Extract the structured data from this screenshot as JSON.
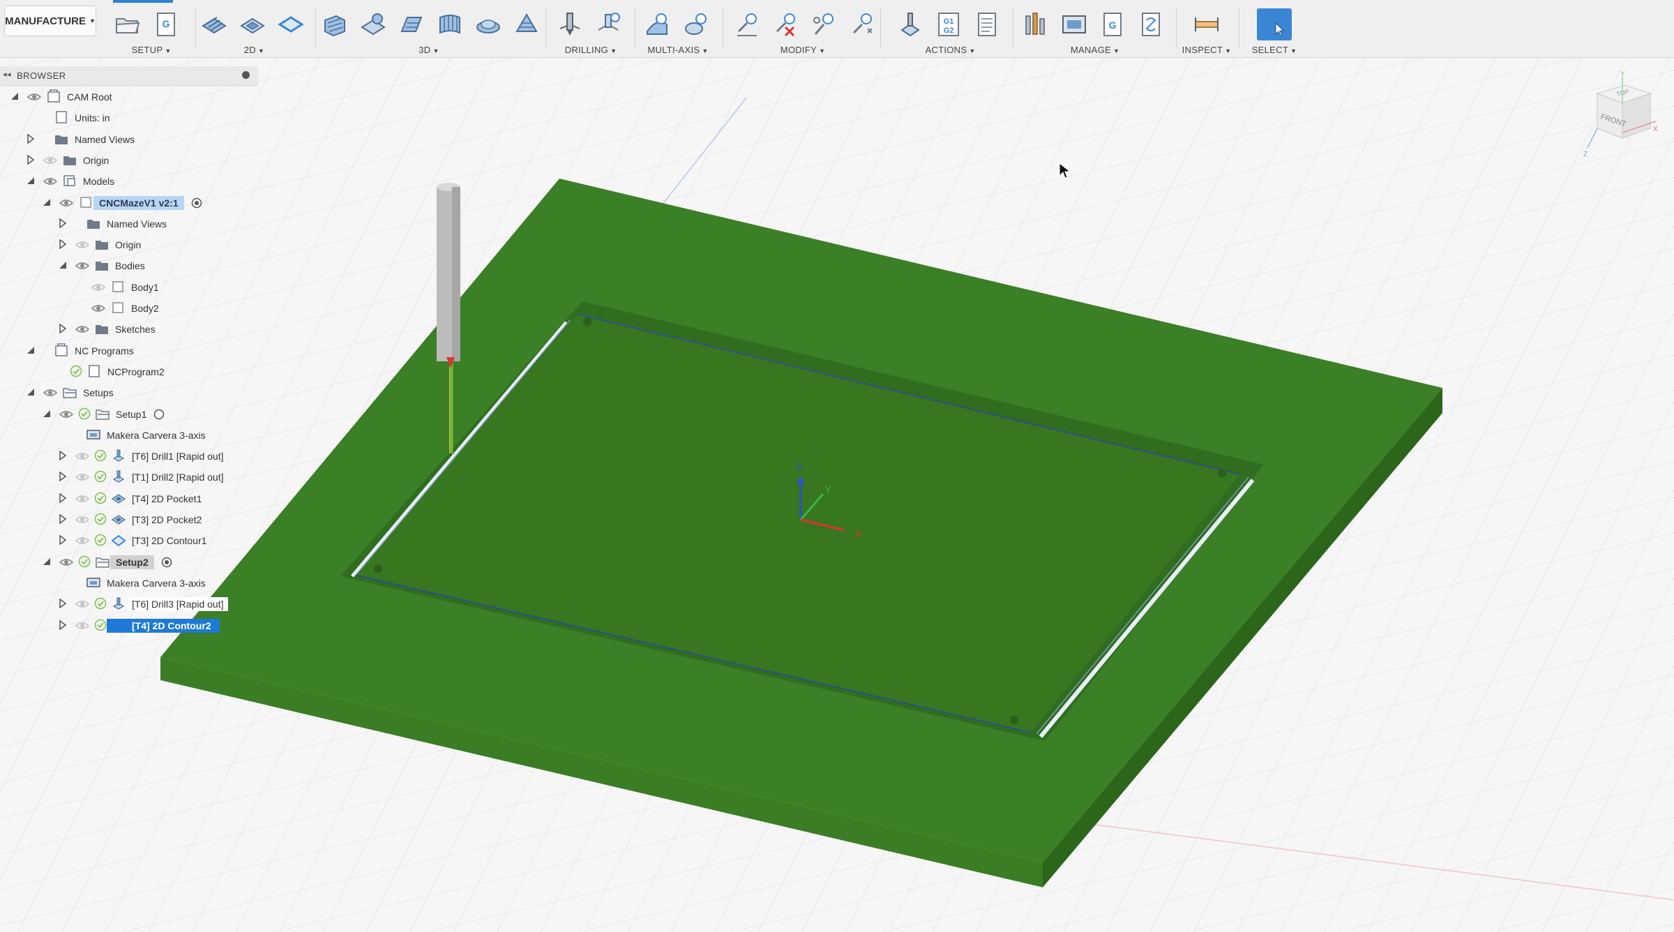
{
  "toolbar": {
    "workspace": "MANUFACTURE",
    "groups": [
      {
        "label": "SETUP"
      },
      {
        "label": "2D"
      },
      {
        "label": "3D"
      },
      {
        "label": "DRILLING"
      },
      {
        "label": "MULTI-AXIS"
      },
      {
        "label": "MODIFY"
      },
      {
        "label": "ACTIONS"
      },
      {
        "label": "MANAGE"
      },
      {
        "label": "INSPECT"
      },
      {
        "label": "SELECT"
      }
    ]
  },
  "browser": {
    "title": "BROWSER",
    "rows": [
      {
        "label": "CAM Root"
      },
      {
        "label": "Units: in"
      },
      {
        "label": "Named Views"
      },
      {
        "label": "Origin"
      },
      {
        "label": "Models"
      },
      {
        "label": "CNCMazeV1 v2:1"
      },
      {
        "label": "Named Views"
      },
      {
        "label": "Origin"
      },
      {
        "label": "Bodies"
      },
      {
        "label": "Body1"
      },
      {
        "label": "Body2"
      },
      {
        "label": "Sketches"
      },
      {
        "label": "NC Programs"
      },
      {
        "label": "NCProgram2"
      },
      {
        "label": "Setups"
      },
      {
        "label": "Setup1"
      },
      {
        "label": "Makera Carvera 3-axis"
      },
      {
        "label": "[T6] Drill1 [Rapid out]"
      },
      {
        "label": "[T1] Drill2 [Rapid out]"
      },
      {
        "label": "[T4] 2D Pocket1"
      },
      {
        "label": "[T3] 2D Pocket2"
      },
      {
        "label": "[T3] 2D Contour1"
      },
      {
        "label": "Setup2"
      },
      {
        "label": "Makera Carvera 3-axis"
      },
      {
        "label": "[T6] Drill3 [Rapid out]"
      },
      {
        "label": "[T4] 2D Contour2"
      }
    ]
  },
  "viewcube": {
    "top": "TOP",
    "front": "FRONT",
    "axis_x": "X",
    "axis_y": "Y",
    "axis_z": "Z"
  },
  "triad": {
    "z": "Z",
    "y": "Y",
    "x": "X"
  },
  "colors": {
    "stock_top": "#3b7f26",
    "stock_side": "#2b661b",
    "accent": "#1e7ad6",
    "grid": "#dcdcdc"
  }
}
